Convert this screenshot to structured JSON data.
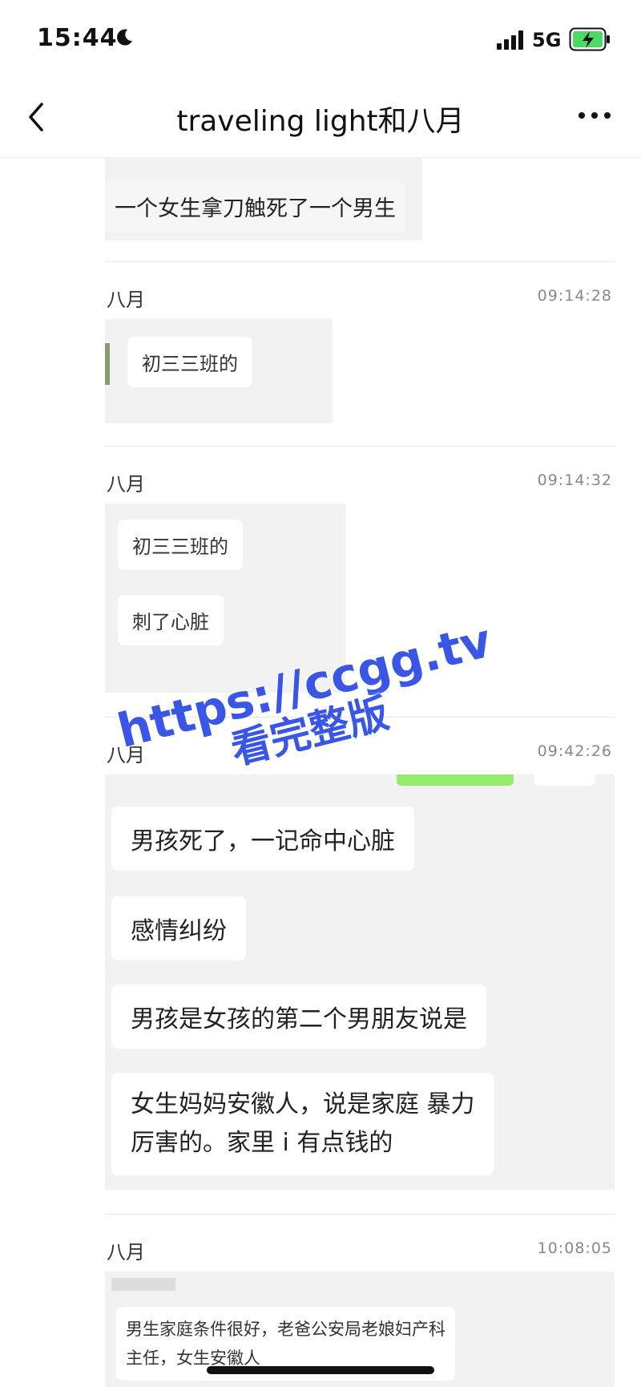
{
  "status": {
    "time": "15:44",
    "network": "5G"
  },
  "header": {
    "title": "traveling light和八月"
  },
  "messages": [
    {
      "bubbles": [
        "一个女生拿刀触死了一个男生"
      ]
    },
    {
      "sender": "八月",
      "time": "09:14:28",
      "bubbles": [
        "初三三班的"
      ]
    },
    {
      "sender": "八月",
      "time": "09:14:32",
      "bubbles": [
        "初三三班的",
        "刺了心脏"
      ]
    },
    {
      "sender": "八月",
      "time": "09:42:26",
      "bubbles": [
        "男孩死了，一记命中心脏",
        "感情纠纷",
        "男孩是女孩的第二个男朋友说是",
        "女生妈妈安徽人，说是家庭 暴力",
        "厉害的。家里 i 有点钱的"
      ]
    },
    {
      "sender": "八月",
      "time": "10:08:05",
      "bubbles": [
        "男生家庭条件很好，老爸公安局老娘妇产科",
        "主任，女生安徽人"
      ]
    }
  ],
  "watermark": {
    "line1": "https://ccgg.tv",
    "line2": "看完整版"
  },
  "colors": {
    "watermark": "#3a56e6",
    "card_bg": "#f2f2f2",
    "bubble_bg": "#ffffff",
    "green_bubble": "#95ec69"
  }
}
